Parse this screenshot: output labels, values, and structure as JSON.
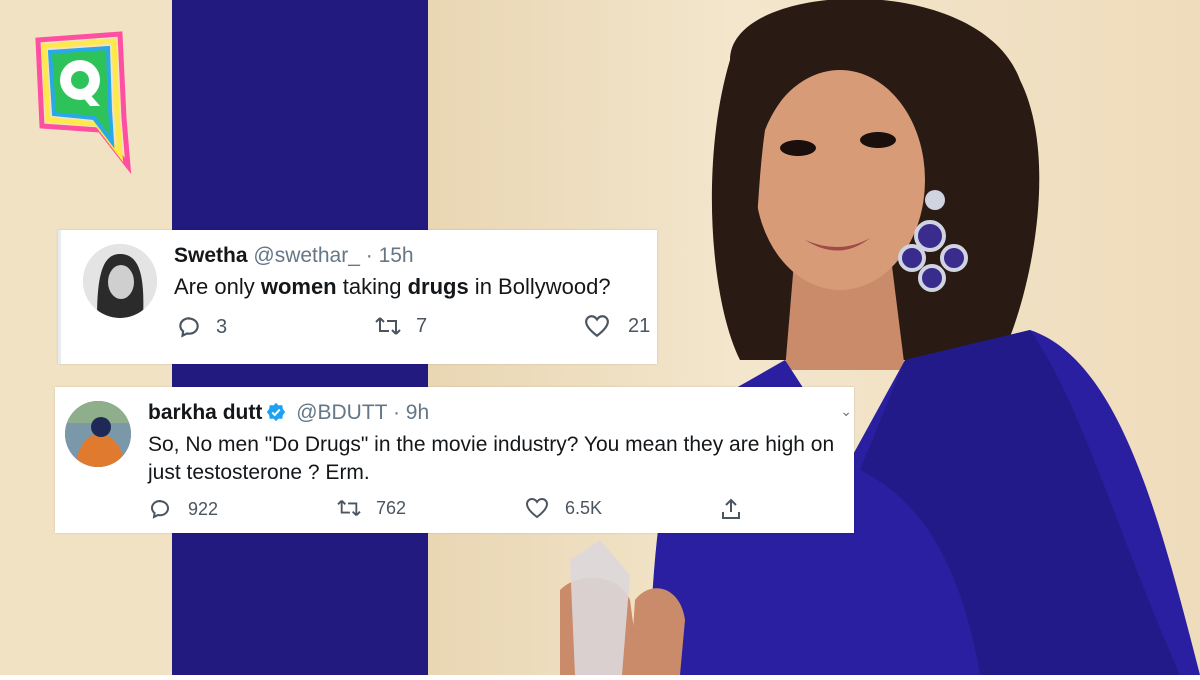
{
  "logo": {
    "icon": "the-quint-logo-icon"
  },
  "tweet1": {
    "name": "Swetha",
    "handle": "@swethar_",
    "time": "· 15h",
    "text_parts": [
      "Are only ",
      "women",
      " taking ",
      "drugs",
      " in Bollywood?"
    ],
    "replies": "3",
    "retweets": "7",
    "likes": "21"
  },
  "tweet2": {
    "name": "barkha dutt",
    "handle": "@BDUTT",
    "time": "· 9h",
    "text": "So, No men \"Do Drugs\" in the movie industry? You mean they are high on just testosterone ? Erm.",
    "replies": "922",
    "retweets": "762",
    "likes": "6.5K"
  },
  "colors": {
    "stripe": "#231a80",
    "background": "#f2e2c4",
    "dress": "#2a1fa0"
  }
}
